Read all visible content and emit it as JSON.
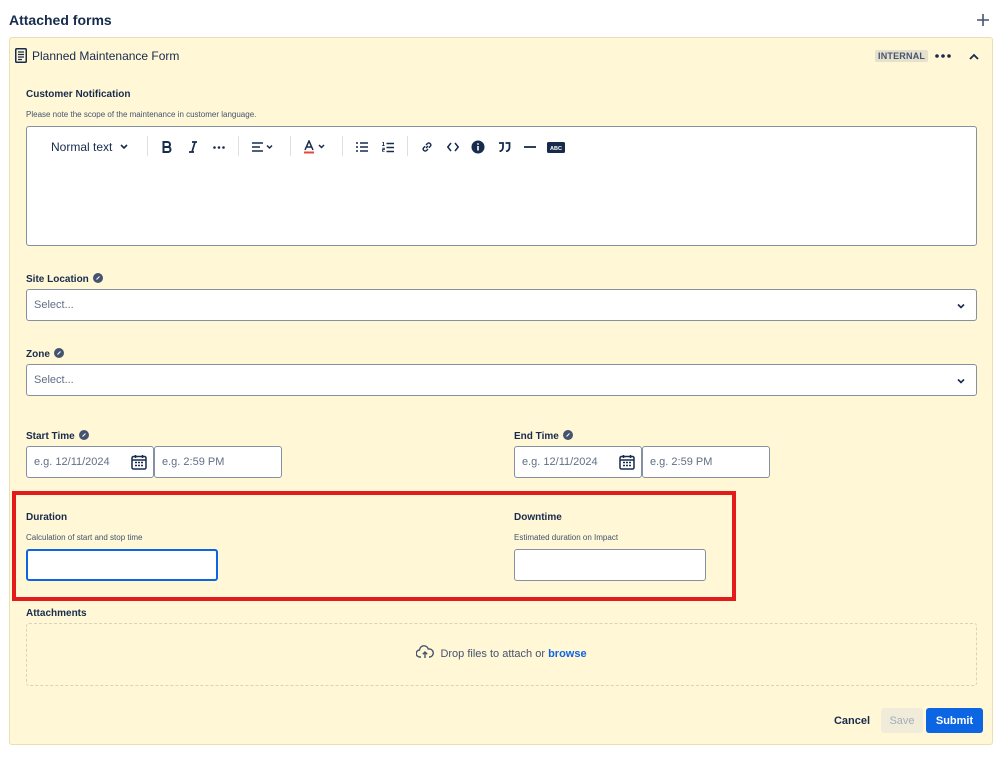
{
  "header": {
    "title": "Attached forms",
    "add_icon": "plus-icon"
  },
  "form": {
    "title": "Planned Maintenance Form",
    "badge": "INTERNAL",
    "doc_icon": "document-icon",
    "more_icon": "more-horizontal-icon",
    "collapse_icon": "chevron-up-icon"
  },
  "customer_notification": {
    "label": "Customer Notification",
    "description": "Please note the scope of the maintenance in customer language.",
    "toolbar": {
      "text_style": "Normal text",
      "tools": [
        "bold-icon",
        "italic-icon",
        "more-formatting-icon",
        "align-icon",
        "text-color-icon",
        "bullet-list-icon",
        "numbered-list-icon",
        "link-icon",
        "code-icon",
        "info-panel-icon",
        "quote-icon",
        "divider-icon",
        "spellcheck-icon"
      ]
    }
  },
  "site_location": {
    "label": "Site Location",
    "placeholder": "Select..."
  },
  "zone": {
    "label": "Zone",
    "placeholder": "Select..."
  },
  "start_time": {
    "label": "Start Time",
    "date_placeholder": "e.g. 12/11/2024",
    "time_placeholder": "e.g. 2:59 PM"
  },
  "end_time": {
    "label": "End Time",
    "date_placeholder": "e.g. 12/11/2024",
    "time_placeholder": "e.g. 2:59 PM"
  },
  "duration": {
    "label": "Duration",
    "description": "Calculation of start and stop time",
    "value": ""
  },
  "downtime": {
    "label": "Downtime",
    "description": "Estimated duration on Impact",
    "value": ""
  },
  "attachments": {
    "label": "Attachments",
    "drop_text": "Drop files to attach or",
    "browse": "browse"
  },
  "actions": {
    "cancel": "Cancel",
    "save": "Save",
    "submit": "Submit"
  },
  "colors": {
    "card_bg": "#fff7d6",
    "primary": "#0c66e4",
    "highlight": "#e41b1b"
  }
}
